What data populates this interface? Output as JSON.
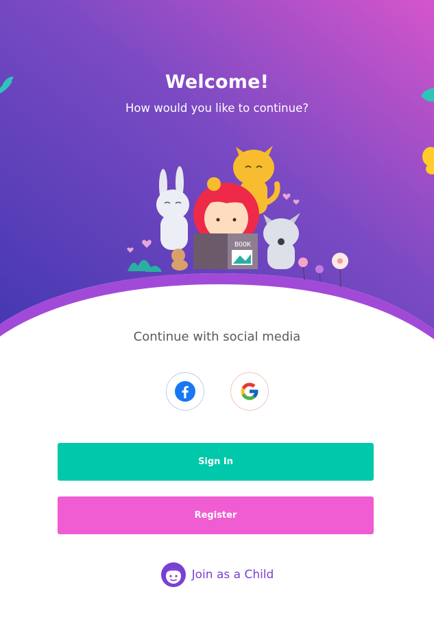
{
  "welcome": {
    "title": "Welcome!",
    "subtitle": "How would you like to continue?"
  },
  "illustration": {
    "book_label": "BOOK"
  },
  "social": {
    "label": "Continue with social media",
    "facebook_icon": "facebook-icon",
    "google_icon": "google-icon"
  },
  "buttons": {
    "sign_in": "Sign In",
    "register": "Register"
  },
  "child": {
    "label": "Join as a Child",
    "icon": "child-face-icon"
  },
  "colors": {
    "gradient_start": "#4a3ab6",
    "gradient_end": "#d353c9",
    "sign_in": "#00c8aa",
    "register": "#f05cd2",
    "accent_text": "#7a3fd3"
  }
}
